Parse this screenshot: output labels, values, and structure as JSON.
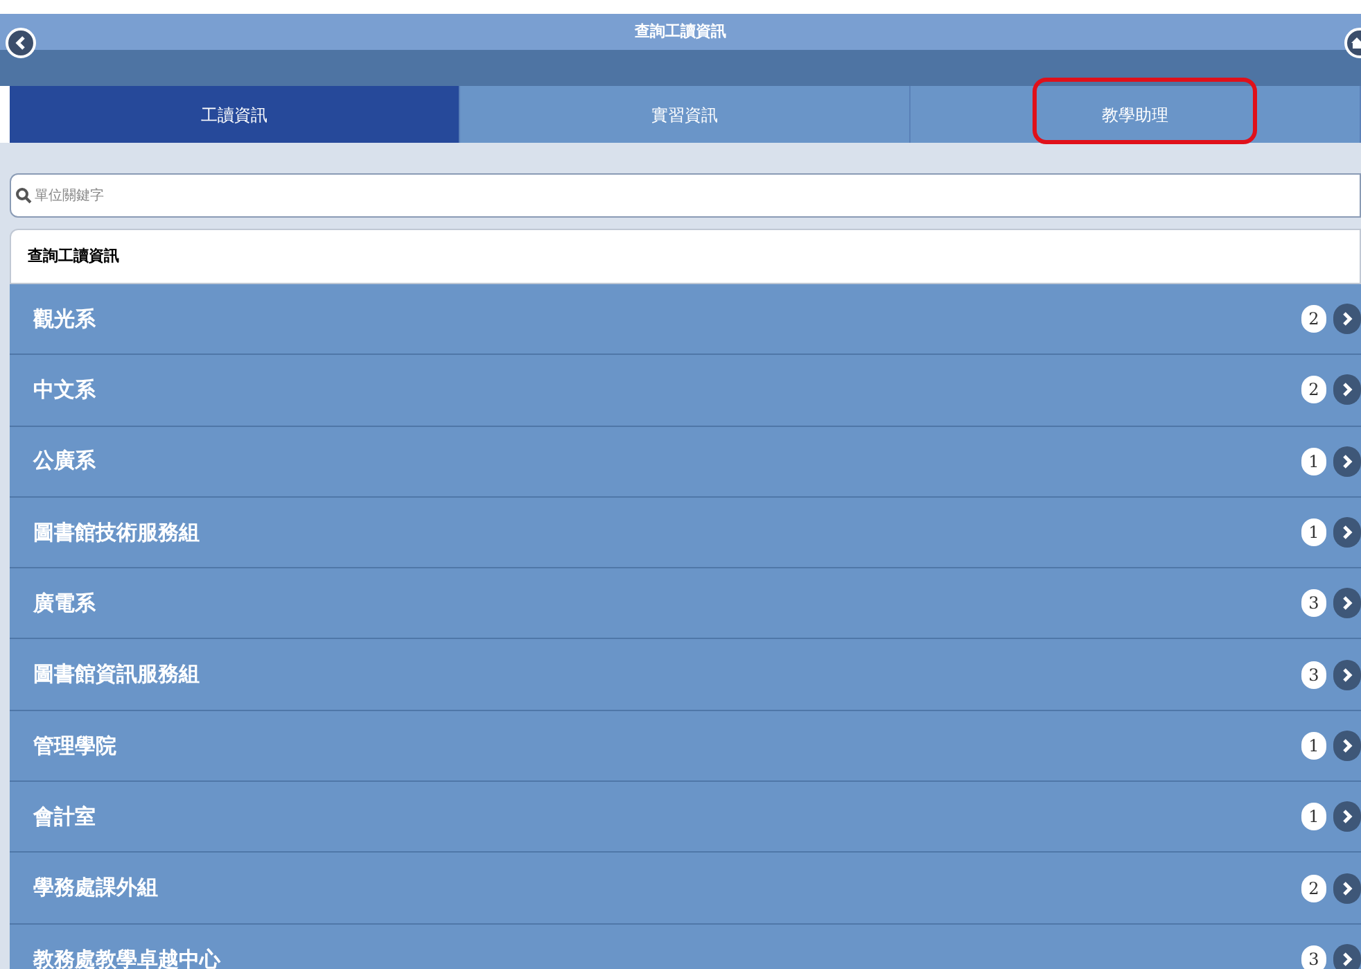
{
  "header": {
    "title": "查詢工讀資訊"
  },
  "tabs": [
    {
      "label": "工讀資訊",
      "selected": true,
      "highlighted": false
    },
    {
      "label": "實習資訊",
      "selected": false,
      "highlighted": false
    },
    {
      "label": "教學助理",
      "selected": false,
      "highlighted": true
    }
  ],
  "search": {
    "placeholder": "單位關鍵字"
  },
  "list": {
    "heading": "查詢工讀資訊",
    "items": [
      {
        "label": "觀光系",
        "count": "2"
      },
      {
        "label": "中文系",
        "count": "2"
      },
      {
        "label": "公廣系",
        "count": "1"
      },
      {
        "label": "圖書館技術服務組",
        "count": "1"
      },
      {
        "label": "廣電系",
        "count": "3"
      },
      {
        "label": "圖書館資訊服務組",
        "count": "3"
      },
      {
        "label": "管理學院",
        "count": "1"
      },
      {
        "label": "會計室",
        "count": "1"
      },
      {
        "label": "學務處課外組",
        "count": "2"
      },
      {
        "label": "教務處教學卓越中心",
        "count": "3"
      }
    ]
  }
}
